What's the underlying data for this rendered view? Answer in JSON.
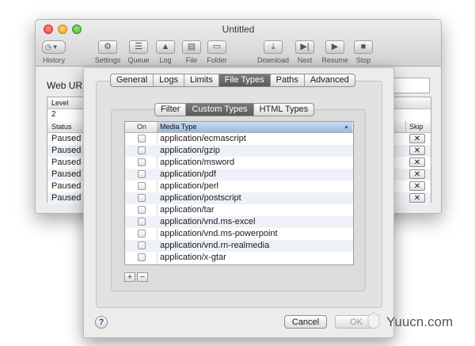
{
  "window": {
    "title": "Untitled"
  },
  "toolbar": {
    "history": "History",
    "settings": "Settings",
    "queue": "Queue",
    "log": "Log",
    "file": "File",
    "folder": "Folder",
    "download": "Download",
    "next": "Next",
    "resume": "Resume",
    "stop": "Stop"
  },
  "main": {
    "web_url_label": "Web URL:",
    "level_header": "Level",
    "level_value": "2",
    "status_header": "Status",
    "skip_header": "Skip",
    "rows": [
      {
        "status": "Paused"
      },
      {
        "status": "Paused"
      },
      {
        "status": "Paused"
      },
      {
        "status": "Paused"
      },
      {
        "status": "Paused"
      },
      {
        "status": "Paused"
      }
    ],
    "skip_glyph": "✕"
  },
  "sheet": {
    "tabs": [
      "General",
      "Logs",
      "Limits",
      "File Types",
      "Paths",
      "Advanced"
    ],
    "selected_tab": "File Types",
    "subtabs": [
      "Filter",
      "Custom Types",
      "HTML Types"
    ],
    "selected_subtab": "Custom Types",
    "list": {
      "col_on": "On",
      "col_type": "Media Type",
      "items": [
        "application/ecmascript",
        "application/gzip",
        "application/msword",
        "application/pdf",
        "application/perl",
        "application/postscript",
        "application/tar",
        "application/vnd.ms-excel",
        "application/vnd.ms-powerpoint",
        "application/vnd.rn-realmedia",
        "application/x-gtar"
      ]
    },
    "add_label": "+",
    "remove_label": "−",
    "help_label": "?",
    "cancel_label": "Cancel",
    "ok_label": "OK"
  },
  "watermark": "Yuucn.com"
}
